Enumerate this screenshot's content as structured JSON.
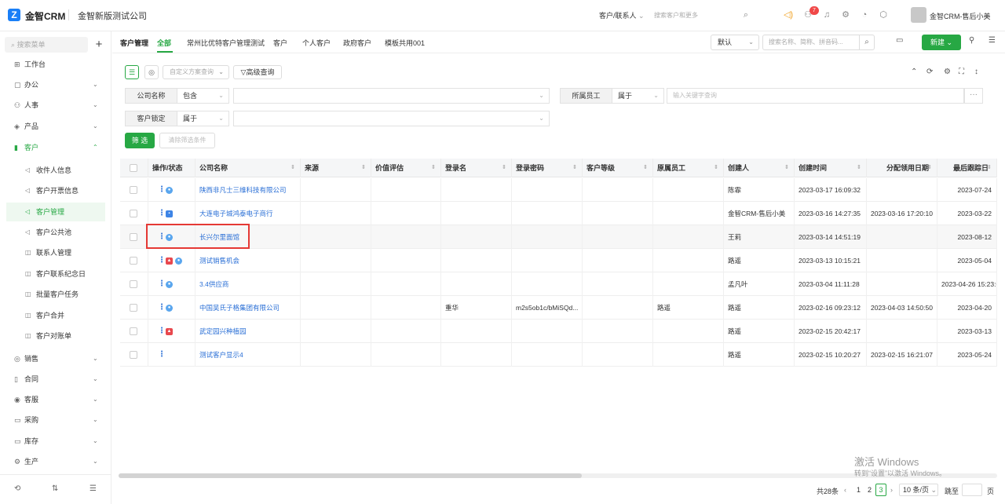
{
  "topbar": {
    "logo_glyph": "Z",
    "brand": "金智CRM",
    "company": "金智新版测试公司",
    "contact_select": "客户/联系人",
    "search_placeholder": "搜索客户和更多",
    "notification_count": "7",
    "username": "金智CRM-售后小美"
  },
  "sidebar": {
    "search_placeholder": "搜索菜单",
    "add_glyph": "+",
    "items": [
      {
        "label": "工作台",
        "icon": "dashboard-icon",
        "glyph": "⊞",
        "arrow": ""
      },
      {
        "label": "办公",
        "icon": "office-icon",
        "glyph": "▢",
        "arrow": "⌄"
      },
      {
        "label": "人事",
        "icon": "people-icon",
        "glyph": "⚇",
        "arrow": "⌄"
      },
      {
        "label": "产品",
        "icon": "product-icon",
        "glyph": "◈",
        "arrow": "⌄"
      },
      {
        "label": "客户",
        "icon": "customer-icon",
        "glyph": "▮",
        "arrow": "⌃"
      }
    ],
    "sub_items": [
      {
        "label": "收件人信息",
        "glyph": "◁"
      },
      {
        "label": "客户开票信息",
        "glyph": "◁"
      },
      {
        "label": "客户管理",
        "glyph": "◁"
      },
      {
        "label": "客户公共池",
        "glyph": "◁"
      },
      {
        "label": "联系人管理",
        "glyph": "◫"
      },
      {
        "label": "客户联系纪念日",
        "glyph": "◫"
      },
      {
        "label": "批量客户任务",
        "glyph": "◫"
      },
      {
        "label": "客户合并",
        "glyph": "◫"
      },
      {
        "label": "客户对账单",
        "glyph": "◫"
      }
    ],
    "items_after": [
      {
        "label": "销售",
        "glyph": "◎",
        "arrow": "⌄"
      },
      {
        "label": "合同",
        "glyph": "▯",
        "arrow": "⌄"
      },
      {
        "label": "客服",
        "glyph": "◉",
        "arrow": "⌄"
      },
      {
        "label": "采购",
        "glyph": "▭",
        "arrow": "⌄"
      },
      {
        "label": "库存",
        "glyph": "▭",
        "arrow": "⌄"
      },
      {
        "label": "生产",
        "glyph": "⚙",
        "arrow": "⌄"
      }
    ],
    "bottom_glyphs": [
      "⟲",
      "⇅",
      "☰"
    ]
  },
  "tabs": {
    "page_label": "客户管理",
    "items": [
      "全部",
      "常州比优特客户管理测试",
      "客户",
      "个人客户",
      "政府客户",
      "模板共用001"
    ]
  },
  "toolbar": {
    "view_default": "默认",
    "search_placeholder": "搜索名称、简称、拼音码...",
    "new_label": "新建"
  },
  "filters": {
    "view_placeholder": "自定义方案查询",
    "advanced_label": "高级查询",
    "company_label": "公司名称",
    "company_op": "包含",
    "staff_label": "所属员工",
    "staff_op": "属于",
    "staff_placeholder": "输入关键字查询",
    "lock_label": "客户锁定",
    "lock_op": "属于",
    "filter_btn": "筛 选",
    "clear_btn": "清除筛选条件"
  },
  "table": {
    "columns": [
      "操作/状态",
      "公司名称",
      "来源",
      "价值评估",
      "登录名",
      "登录密码",
      "客户等级",
      "原属员工",
      "创建人",
      "创建时间",
      "分配领用日期",
      "最后跟踪日"
    ],
    "rows": [
      {
        "name": "陕西非凡士三维科技有限公司",
        "source": "",
        "value": "",
        "login": "",
        "password": "",
        "level": "",
        "orig_staff": "",
        "creator": "陈霏",
        "created": "2023-03-17 16:09:32",
        "assigned": "",
        "last": "2023-07-24",
        "icons": [
          "circle"
        ]
      },
      {
        "name": "大连电子城鸿泰电子商行",
        "source": "",
        "value": "",
        "login": "",
        "password": "",
        "level": "",
        "orig_staff": "",
        "creator": "金智CRM-售后小美",
        "created": "2023-03-16 14:27:35",
        "assigned": "2023-03-16 17:20:10",
        "last": "2023-03-22",
        "icons": [
          "square"
        ]
      },
      {
        "name": "长兴尔里面馆",
        "source": "",
        "value": "",
        "login": "",
        "password": "",
        "level": "",
        "orig_staff": "",
        "creator": "王莉",
        "created": "2023-03-14 14:51:19",
        "assigned": "",
        "last": "2023-08-12",
        "icons": [
          "circle"
        ]
      },
      {
        "name": "测试销售机会",
        "source": "",
        "value": "",
        "login": "",
        "password": "",
        "level": "",
        "orig_staff": "",
        "creator": "路遥",
        "created": "2023-03-13 10:15:21",
        "assigned": "",
        "last": "2023-05-04",
        "icons": [
          "red",
          "circle"
        ]
      },
      {
        "name": "3.4供应商",
        "source": "",
        "value": "",
        "login": "",
        "password": "",
        "level": "",
        "orig_staff": "",
        "creator": "孟凡叶",
        "created": "2023-03-04 11:11:28",
        "assigned": "",
        "last": "2023-04-26 15:23:0",
        "icons": [
          "circle"
        ]
      },
      {
        "name": "中国吴氏子格集团有限公司",
        "source": "",
        "value": "",
        "login": "重华",
        "password": "m2s5ob1c/bMiSQd...",
        "level": "",
        "orig_staff": "路遥",
        "creator": "路遥",
        "created": "2023-02-16 09:23:12",
        "assigned": "2023-04-03 14:50:50",
        "last": "2023-04-20",
        "icons": [
          "circle"
        ]
      },
      {
        "name": "武定园兴种植园",
        "source": "",
        "value": "",
        "login": "",
        "password": "",
        "level": "",
        "orig_staff": "",
        "creator": "路遥",
        "created": "2023-02-15 20:42:17",
        "assigned": "",
        "last": "2023-03-13",
        "icons": [
          "red"
        ]
      },
      {
        "name": "测试客户显示4",
        "source": "",
        "value": "",
        "login": "",
        "password": "",
        "level": "",
        "orig_staff": "",
        "creator": "路遥",
        "created": "2023-02-15 10:20:27",
        "assigned": "2023-02-15 16:21:07",
        "last": "2023-05-24",
        "icons": []
      }
    ]
  },
  "pager": {
    "total": "共28条",
    "pages": [
      "1",
      "2",
      "3"
    ],
    "current": "3",
    "page_size": "10 条/页",
    "goto_label": "跳至",
    "page_suffix": "页"
  },
  "watermark": {
    "line1": "激活 Windows",
    "line2": "转到“设置”以激活 Windows。"
  },
  "colors": {
    "accent": "#27a844",
    "link": "#2a6fd6",
    "highlight_border": "#e53935"
  }
}
